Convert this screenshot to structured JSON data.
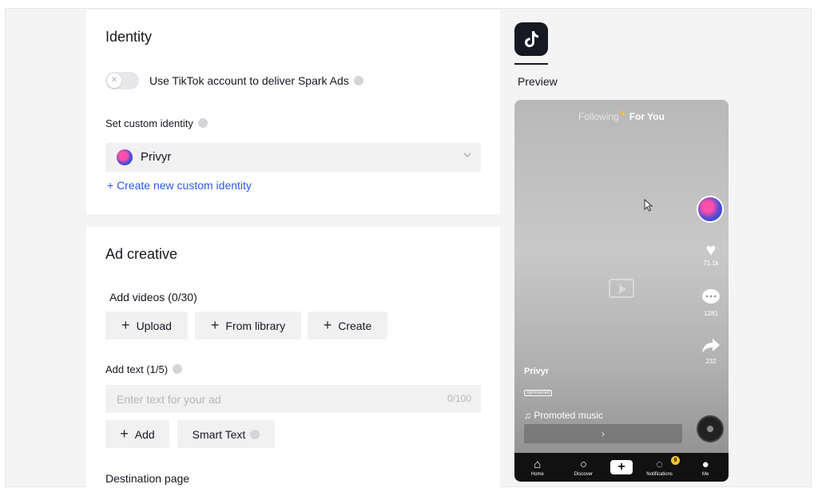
{
  "identity": {
    "title": "Identity",
    "spark_toggle_label": "Use TikTok account to deliver Spark Ads",
    "custom_identity_label": "Set custom identity",
    "selected_identity": "Privyr",
    "create_link": "+ Create new custom identity"
  },
  "ad_creative": {
    "title": "Ad creative",
    "add_videos_label": "Add videos (0/30)",
    "upload": "Upload",
    "from_library": "From library",
    "create": "Create",
    "add_text_label": "Add text (1/5)",
    "text_placeholder": "Enter text for your ad",
    "text_count": "0/100",
    "add": "Add",
    "smart_text": "Smart Text",
    "destination_label": "Destination page"
  },
  "preview": {
    "label": "Preview",
    "tab_following": "Following",
    "tab_for_you": "For You",
    "likes": "71.1k",
    "comments": "1281",
    "shares": "232",
    "username": "Privyr",
    "sponsored": "Sponsored",
    "music": "♫ Promoted music",
    "cta_arrow": "›",
    "nav": {
      "home": "Home",
      "discover": "Discover",
      "notifications": "Notifications",
      "notifications_badge": "9",
      "me": "Me"
    }
  }
}
